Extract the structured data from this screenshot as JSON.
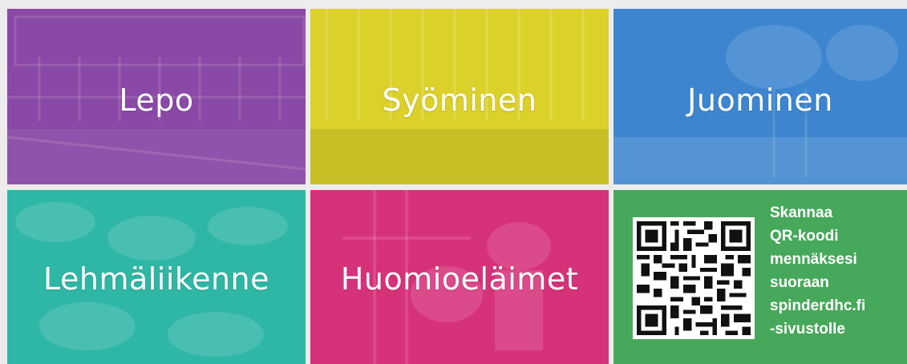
{
  "tiles": [
    {
      "label": "Lepo",
      "color": "#8a49a6"
    },
    {
      "label": "Syöminen",
      "color": "#dcd02a"
    },
    {
      "label": "Juominen",
      "color": "#3d86cf"
    },
    {
      "label": "Lehmäliikenne",
      "color": "#2fb7a6"
    },
    {
      "label": "Huomioeläimet",
      "color": "#d6327a"
    }
  ],
  "qr_card": {
    "color": "#46a85a",
    "lines": [
      "Skannaa",
      "QR-koodi",
      "mennäksesi",
      "suoraan",
      "spinderdhc.fi",
      "-sivustolle"
    ]
  }
}
